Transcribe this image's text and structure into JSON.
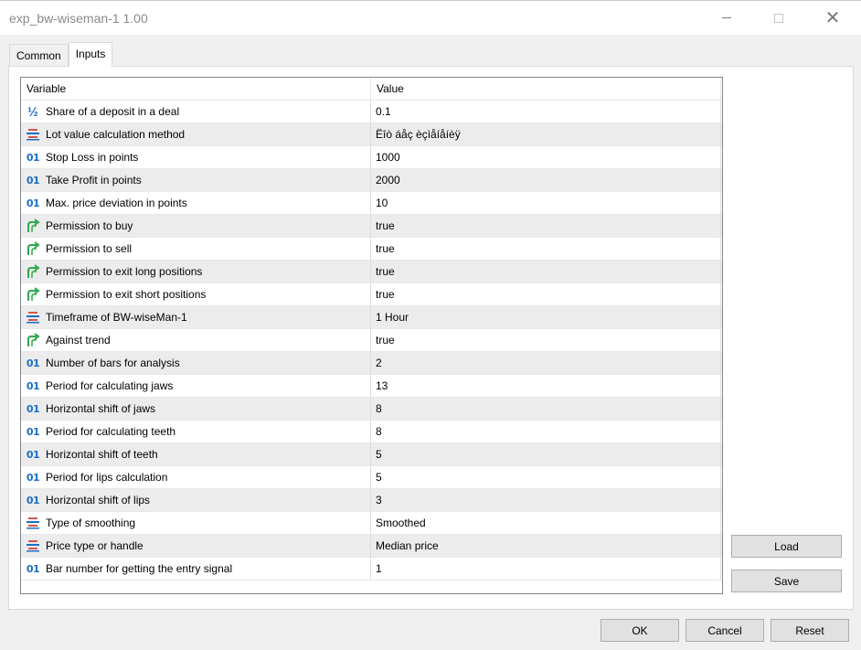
{
  "window": {
    "title": "exp_bw-wiseman-1 1.00",
    "minimize_icon": "minimize-icon",
    "maximize_icon": "maximize-icon",
    "close_icon": "close-icon"
  },
  "tabs": [
    {
      "label": "Common",
      "active": false
    },
    {
      "label": "Inputs",
      "active": true
    }
  ],
  "grid": {
    "headers": {
      "variable": "Variable",
      "value": "Value"
    },
    "rows": [
      {
        "icon": "fraction-icon",
        "variable": "Share of a deposit in a deal",
        "value": "0.1"
      },
      {
        "icon": "enum-icon",
        "variable": "Lot value calculation method",
        "value": "Ëîò áåç èçìåíåíèÿ"
      },
      {
        "icon": "integer-icon",
        "variable": "Stop Loss in points",
        "value": "1000"
      },
      {
        "icon": "integer-icon",
        "variable": "Take Profit in points",
        "value": "2000"
      },
      {
        "icon": "integer-icon",
        "variable": "Max. price deviation in points",
        "value": "10"
      },
      {
        "icon": "bool-icon",
        "variable": "Permission to buy",
        "value": "true"
      },
      {
        "icon": "bool-icon",
        "variable": "Permission to sell",
        "value": "true"
      },
      {
        "icon": "bool-icon",
        "variable": "Permission to exit long positions",
        "value": "true"
      },
      {
        "icon": "bool-icon",
        "variable": "Permission to exit short positions",
        "value": "true"
      },
      {
        "icon": "enum-icon",
        "variable": "Timeframe of BW-wiseMan-1",
        "value": "1 Hour"
      },
      {
        "icon": "bool-icon",
        "variable": "Against trend",
        "value": "true"
      },
      {
        "icon": "integer-icon",
        "variable": "Number of bars for analysis",
        "value": "2"
      },
      {
        "icon": "integer-icon",
        "variable": "Period for calculating jaws",
        "value": "13"
      },
      {
        "icon": "integer-icon",
        "variable": "Horizontal shift of jaws",
        "value": "8"
      },
      {
        "icon": "integer-icon",
        "variable": "Period for calculating teeth",
        "value": "8"
      },
      {
        "icon": "integer-icon",
        "variable": "Horizontal shift of teeth",
        "value": "5"
      },
      {
        "icon": "integer-icon",
        "variable": "Period for lips calculation",
        "value": "5"
      },
      {
        "icon": "integer-icon",
        "variable": "Horizontal shift of lips",
        "value": "3"
      },
      {
        "icon": "enum-icon",
        "variable": "Type of smoothing",
        "value": "Smoothed"
      },
      {
        "icon": "enum-icon",
        "variable": "Price type or handle",
        "value": "Median price"
      },
      {
        "icon": "integer-icon",
        "variable": "Bar number for getting the entry signal",
        "value": "1"
      }
    ]
  },
  "buttons": {
    "load": "Load",
    "save": "Save",
    "ok": "OK",
    "cancel": "Cancel",
    "reset": "Reset"
  },
  "colors": {
    "accent_blue": "#1c6fc4",
    "bool_green": "#2fa84f",
    "enum_red": "#d9534f"
  }
}
